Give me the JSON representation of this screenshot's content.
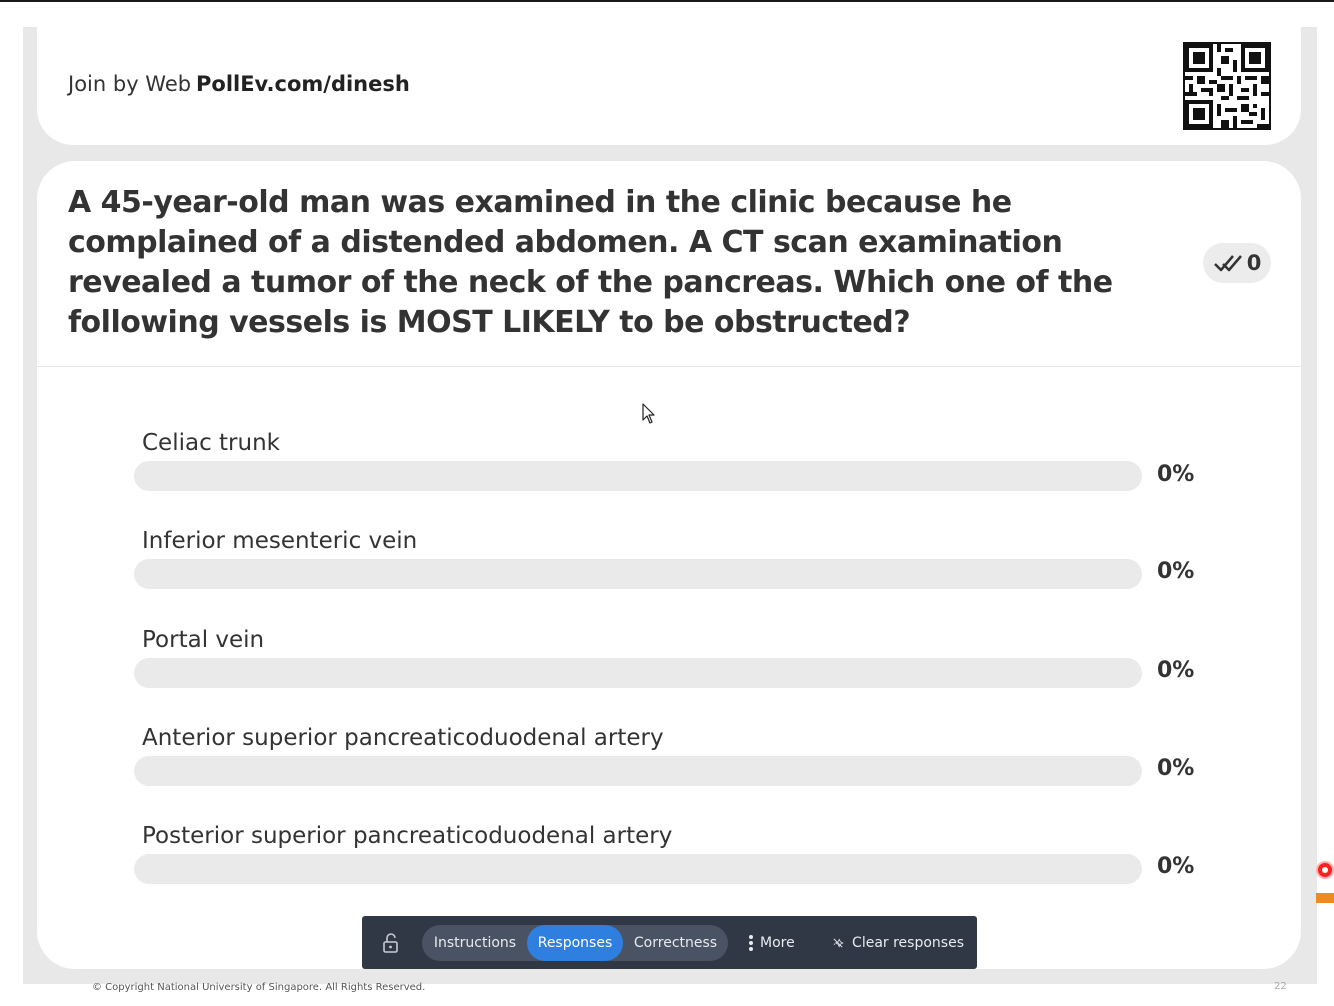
{
  "join": {
    "label": "Join by Web",
    "url": "PollEv.com/dinesh"
  },
  "question": {
    "text": "A 45-year-old man was examined in the clinic because he complained of a distended abdomen. A CT scan examination revealed a tumor of the neck of the pancreas. Which one of the following vessels is MOST LIKELY to be obstructed?",
    "response_count": "0"
  },
  "options": [
    {
      "label": "Celiac trunk",
      "percent_text": "0%",
      "percent": 0
    },
    {
      "label": "Inferior mesenteric vein",
      "percent_text": "0%",
      "percent": 0
    },
    {
      "label": "Portal vein",
      "percent_text": "0%",
      "percent": 0
    },
    {
      "label": "Anterior superior pancreaticoduodenal artery",
      "percent_text": "0%",
      "percent": 0
    },
    {
      "label": "Posterior superior pancreaticoduodenal artery",
      "percent_text": "0%",
      "percent": 0
    }
  ],
  "toolbar": {
    "instructions": "Instructions",
    "responses": "Responses",
    "correctness": "Correctness",
    "more": "More",
    "clear": "Clear responses",
    "active_tab": "Responses"
  },
  "footer": {
    "copyright": "© Copyright National University of Singapore. All Rights Reserved.",
    "page": "22"
  },
  "colors": {
    "accent": "#2f7fe0",
    "toolbar_bg": "#303845",
    "bar_bg": "#eaeaea",
    "record": "#ff1f1f"
  },
  "icons": [
    "qr-code-icon",
    "checkmark-icon",
    "mouse-cursor-icon",
    "unlock-icon",
    "more-vertical-icon",
    "clear-sparkle-icon",
    "record-icon"
  ]
}
